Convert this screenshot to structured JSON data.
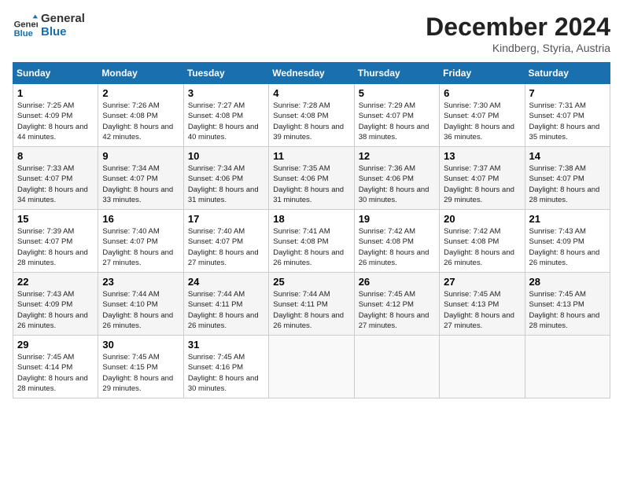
{
  "header": {
    "logo_line1": "General",
    "logo_line2": "Blue",
    "month": "December 2024",
    "location": "Kindberg, Styria, Austria"
  },
  "days_of_week": [
    "Sunday",
    "Monday",
    "Tuesday",
    "Wednesday",
    "Thursday",
    "Friday",
    "Saturday"
  ],
  "weeks": [
    [
      {
        "day": "1",
        "sunrise": "7:25 AM",
        "sunset": "4:09 PM",
        "daylight": "8 hours and 44 minutes."
      },
      {
        "day": "2",
        "sunrise": "7:26 AM",
        "sunset": "4:08 PM",
        "daylight": "8 hours and 42 minutes."
      },
      {
        "day": "3",
        "sunrise": "7:27 AM",
        "sunset": "4:08 PM",
        "daylight": "8 hours and 40 minutes."
      },
      {
        "day": "4",
        "sunrise": "7:28 AM",
        "sunset": "4:08 PM",
        "daylight": "8 hours and 39 minutes."
      },
      {
        "day": "5",
        "sunrise": "7:29 AM",
        "sunset": "4:07 PM",
        "daylight": "8 hours and 38 minutes."
      },
      {
        "day": "6",
        "sunrise": "7:30 AM",
        "sunset": "4:07 PM",
        "daylight": "8 hours and 36 minutes."
      },
      {
        "day": "7",
        "sunrise": "7:31 AM",
        "sunset": "4:07 PM",
        "daylight": "8 hours and 35 minutes."
      }
    ],
    [
      {
        "day": "8",
        "sunrise": "7:33 AM",
        "sunset": "4:07 PM",
        "daylight": "8 hours and 34 minutes."
      },
      {
        "day": "9",
        "sunrise": "7:34 AM",
        "sunset": "4:07 PM",
        "daylight": "8 hours and 33 minutes."
      },
      {
        "day": "10",
        "sunrise": "7:34 AM",
        "sunset": "4:06 PM",
        "daylight": "8 hours and 31 minutes."
      },
      {
        "day": "11",
        "sunrise": "7:35 AM",
        "sunset": "4:06 PM",
        "daylight": "8 hours and 31 minutes."
      },
      {
        "day": "12",
        "sunrise": "7:36 AM",
        "sunset": "4:06 PM",
        "daylight": "8 hours and 30 minutes."
      },
      {
        "day": "13",
        "sunrise": "7:37 AM",
        "sunset": "4:07 PM",
        "daylight": "8 hours and 29 minutes."
      },
      {
        "day": "14",
        "sunrise": "7:38 AM",
        "sunset": "4:07 PM",
        "daylight": "8 hours and 28 minutes."
      }
    ],
    [
      {
        "day": "15",
        "sunrise": "7:39 AM",
        "sunset": "4:07 PM",
        "daylight": "8 hours and 28 minutes."
      },
      {
        "day": "16",
        "sunrise": "7:40 AM",
        "sunset": "4:07 PM",
        "daylight": "8 hours and 27 minutes."
      },
      {
        "day": "17",
        "sunrise": "7:40 AM",
        "sunset": "4:07 PM",
        "daylight": "8 hours and 27 minutes."
      },
      {
        "day": "18",
        "sunrise": "7:41 AM",
        "sunset": "4:08 PM",
        "daylight": "8 hours and 26 minutes."
      },
      {
        "day": "19",
        "sunrise": "7:42 AM",
        "sunset": "4:08 PM",
        "daylight": "8 hours and 26 minutes."
      },
      {
        "day": "20",
        "sunrise": "7:42 AM",
        "sunset": "4:08 PM",
        "daylight": "8 hours and 26 minutes."
      },
      {
        "day": "21",
        "sunrise": "7:43 AM",
        "sunset": "4:09 PM",
        "daylight": "8 hours and 26 minutes."
      }
    ],
    [
      {
        "day": "22",
        "sunrise": "7:43 AM",
        "sunset": "4:09 PM",
        "daylight": "8 hours and 26 minutes."
      },
      {
        "day": "23",
        "sunrise": "7:44 AM",
        "sunset": "4:10 PM",
        "daylight": "8 hours and 26 minutes."
      },
      {
        "day": "24",
        "sunrise": "7:44 AM",
        "sunset": "4:11 PM",
        "daylight": "8 hours and 26 minutes."
      },
      {
        "day": "25",
        "sunrise": "7:44 AM",
        "sunset": "4:11 PM",
        "daylight": "8 hours and 26 minutes."
      },
      {
        "day": "26",
        "sunrise": "7:45 AM",
        "sunset": "4:12 PM",
        "daylight": "8 hours and 27 minutes."
      },
      {
        "day": "27",
        "sunrise": "7:45 AM",
        "sunset": "4:13 PM",
        "daylight": "8 hours and 27 minutes."
      },
      {
        "day": "28",
        "sunrise": "7:45 AM",
        "sunset": "4:13 PM",
        "daylight": "8 hours and 28 minutes."
      }
    ],
    [
      {
        "day": "29",
        "sunrise": "7:45 AM",
        "sunset": "4:14 PM",
        "daylight": "8 hours and 28 minutes."
      },
      {
        "day": "30",
        "sunrise": "7:45 AM",
        "sunset": "4:15 PM",
        "daylight": "8 hours and 29 minutes."
      },
      {
        "day": "31",
        "sunrise": "7:45 AM",
        "sunset": "4:16 PM",
        "daylight": "8 hours and 30 minutes."
      },
      null,
      null,
      null,
      null
    ]
  ]
}
